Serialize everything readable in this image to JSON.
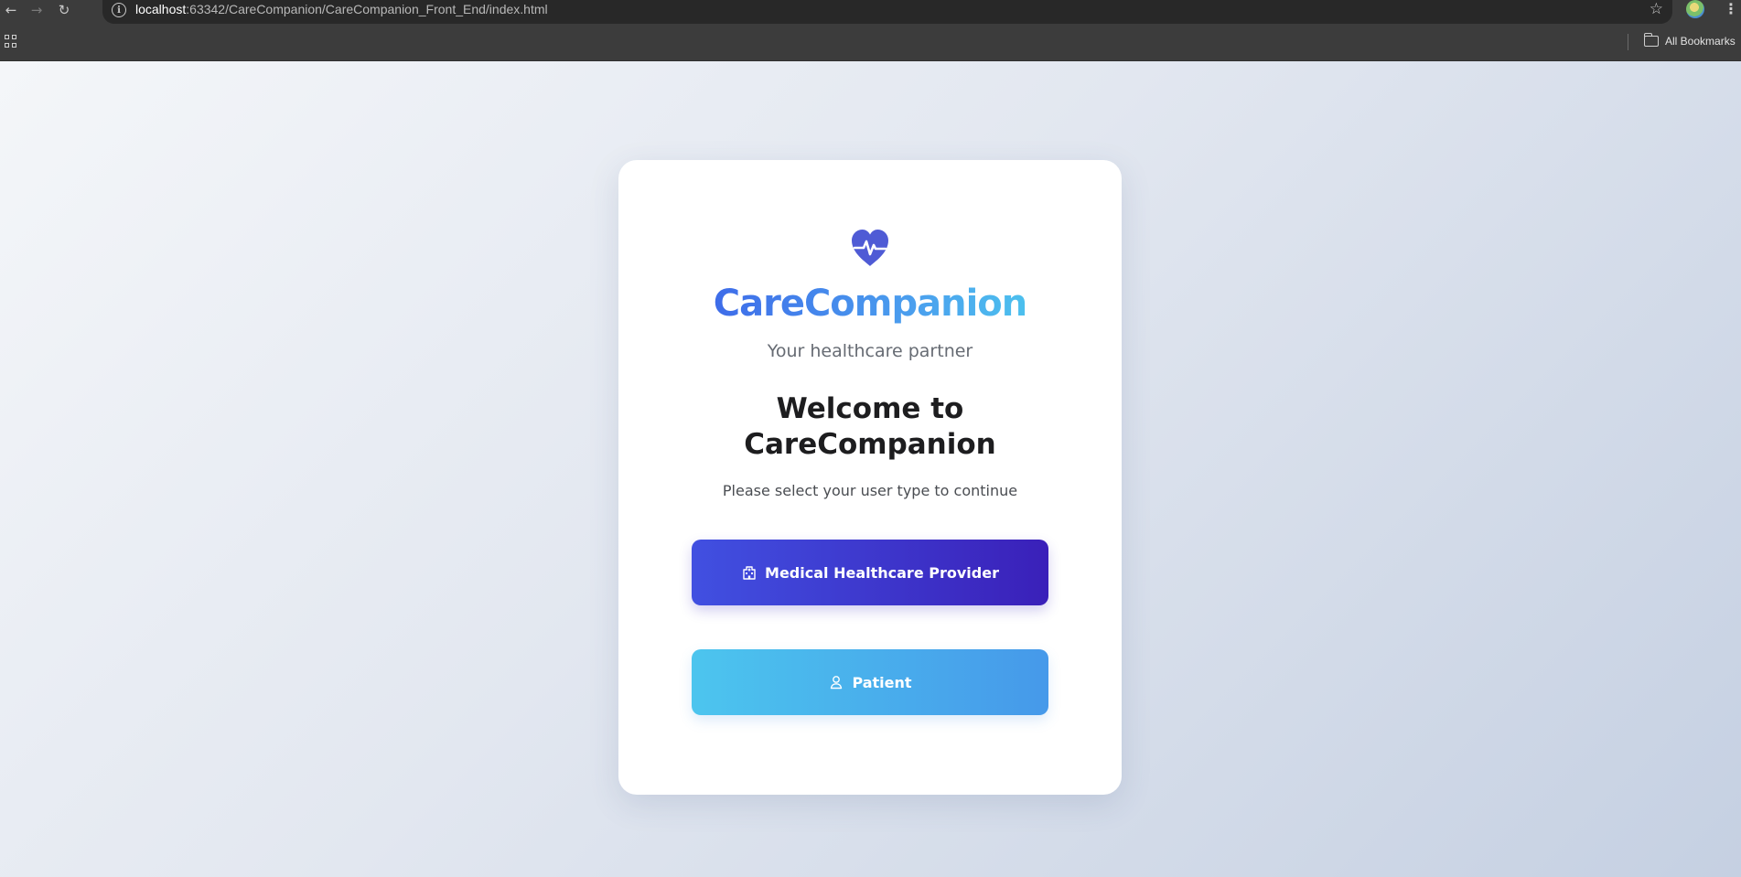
{
  "browser": {
    "url_host": "localhost",
    "url_rest": ":63342/CareCompanion/CareCompanion_Front_End/index.html",
    "bookmarks_label": "All Bookmarks",
    "back_icon": "arrow-left-icon",
    "forward_icon": "arrow-right-icon",
    "reload_icon": "reload-icon",
    "star_icon": "star-icon",
    "apps_icon": "apps-grid-icon",
    "folder_icon": "folder-icon"
  },
  "app": {
    "brand_name": "CareCompanion",
    "tagline": "Your healthcare partner",
    "logo_icon": "heart-pulse-icon",
    "accent_color": "#4f5bd5"
  },
  "welcome": {
    "title_line1": "Welcome to",
    "title_line2": "CareCompanion",
    "prompt": "Please select your user type to continue"
  },
  "buttons": {
    "provider_label": "Medical Healthcare Provider",
    "provider_icon": "hospital-icon",
    "provider_colors": [
      "#4150e1",
      "#3a20b9"
    ],
    "patient_label": "Patient",
    "patient_icon": "user-icon",
    "patient_colors": [
      "#4cc5ee",
      "#4699ea"
    ]
  }
}
